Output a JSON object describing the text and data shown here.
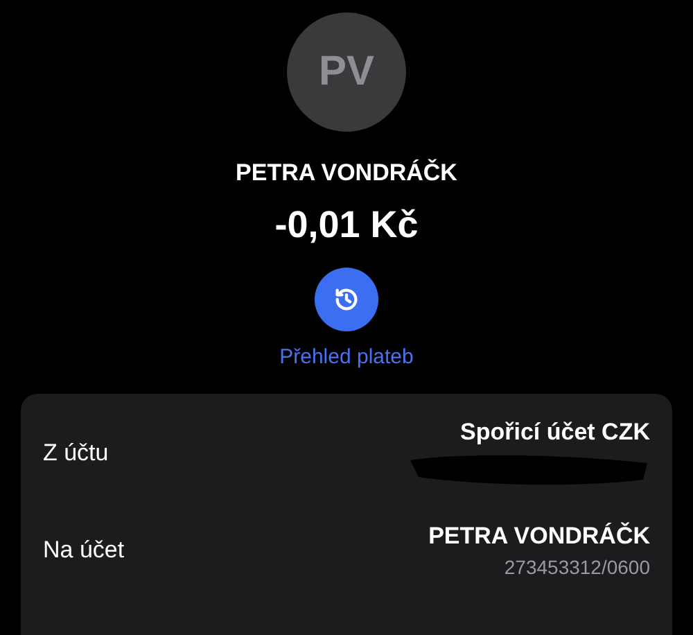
{
  "contact": {
    "initials": "PV",
    "name": "PETRA VONDRÁČK",
    "amount": "-0,01 Kč"
  },
  "history_link": {
    "label": "Přehled plateb"
  },
  "details": [
    {
      "label": "Z účtu",
      "title": "Spořicí účet CZK",
      "redacted": true
    },
    {
      "label": "Na účet",
      "title": "PETRA VONDRÁČK",
      "detail": "273453312/0600",
      "redacted": false
    }
  ]
}
